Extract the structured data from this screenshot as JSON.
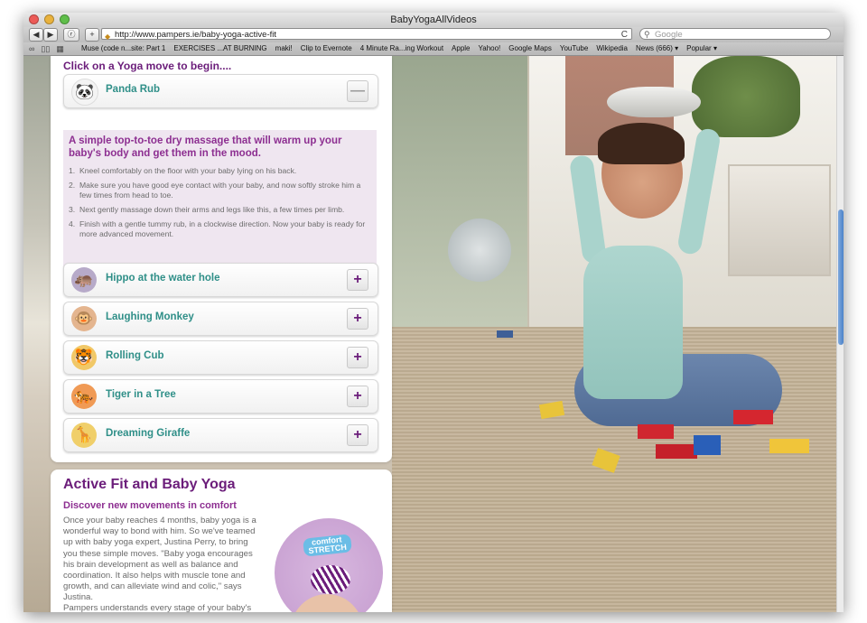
{
  "window": {
    "title": "BabyYogaAllVideos"
  },
  "toolbar": {
    "back_label": "◀",
    "forward_label": "▶",
    "reader_label": "ⓡ",
    "add_label": "+",
    "url": "http://www.pampers.ie/baby-yoga-active-fit",
    "reload_label": "C",
    "search_placeholder": "Google"
  },
  "bookmarks": [
    "Muse (code n...site: Part 1",
    "EXERCISES ...AT BURNING",
    "maki!",
    "Clip to Evernote",
    "4 Minute Ra...ing Workout",
    "Apple",
    "Yahoo!",
    "Google Maps",
    "YouTube",
    "Wikipedia",
    "News (666) ▾",
    "Popular ▾"
  ],
  "yoga_panel": {
    "heading": "Click on a Yoga move to begin....",
    "expanded": {
      "name": "Panda Rub",
      "button": "—",
      "title": "A simple top-to-toe dry massage that will warm up your baby's body and get them in the mood.",
      "steps": [
        {
          "num": "1.",
          "text": "Kneel comfortably on the floor with your baby lying on his back."
        },
        {
          "num": "2.",
          "text": "Make sure you have good eye contact with your baby, and now softly stroke him a few times from head to toe."
        },
        {
          "num": "3.",
          "text": "Next gently massage down their arms and legs like this, a few times per limb."
        },
        {
          "num": "4.",
          "text": "Finish with a gentle tummy rub, in a clockwise direction. Now your baby is ready for more advanced movement."
        }
      ]
    },
    "moves": [
      {
        "name": "Hippo at the water hole",
        "button": "+",
        "icon": "hippo-icon",
        "color": "#9b8fb0"
      },
      {
        "name": "Laughing Monkey",
        "button": "+",
        "icon": "monkey-icon",
        "color": "#c98a5a"
      },
      {
        "name": "Rolling Cub",
        "button": "+",
        "icon": "cub-icon",
        "color": "#e0a63a"
      },
      {
        "name": "Tiger in a Tree",
        "button": "+",
        "icon": "tiger-icon",
        "color": "#e06a2a"
      },
      {
        "name": "Dreaming Giraffe",
        "button": "+",
        "icon": "giraffe-icon",
        "color": "#d9b03a"
      }
    ]
  },
  "active_fit": {
    "title": "Active Fit and Baby Yoga",
    "subtitle": "Discover new movements in comfort",
    "paragraph1": "Once your baby reaches 4 months, baby yoga is a wonderful way to bond with him. So we've teamed up with baby yoga expert, Justina Perry, to bring you these simple moves. \"Baby yoga encourages his brain development as well as balance and coordination. It also helps with muscle tone and growth, and can alleviate wind and colic,\" says Justina.",
    "paragraph2": "Pampers understands every stage of your baby's development and designs nappies to meet his",
    "product_badge_1": "comfort",
    "product_badge_2": "STRETCH"
  },
  "colors": {
    "accent_purple": "#6b1d7a",
    "teal_label": "#2f8f88",
    "lilac_bg": "#efe6f0"
  }
}
